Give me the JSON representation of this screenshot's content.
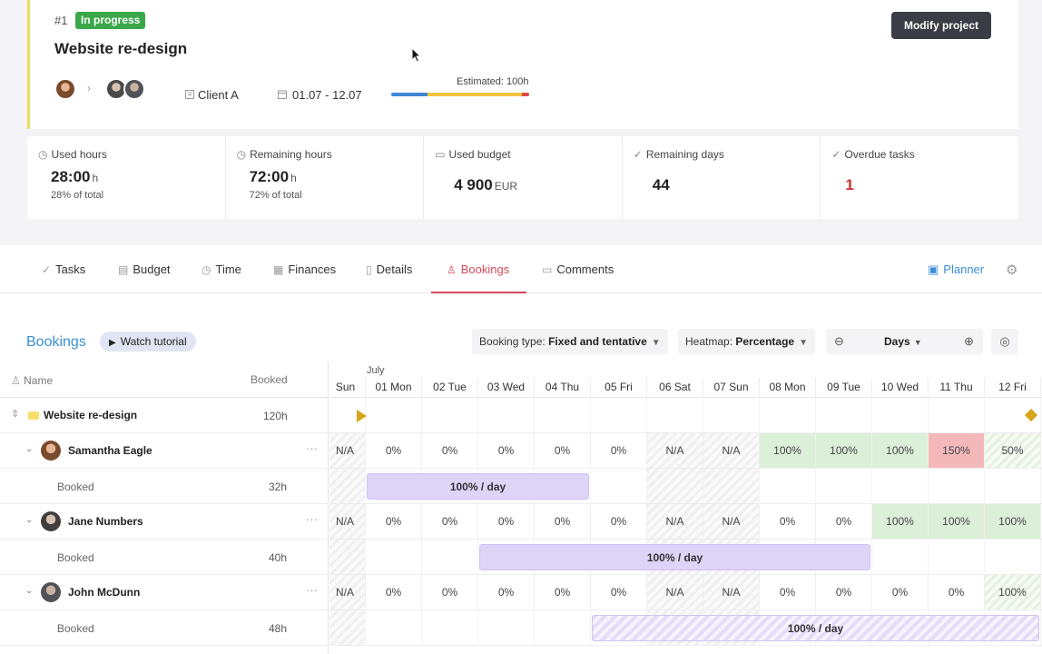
{
  "project": {
    "number": "#1",
    "status": "In progress",
    "title": "Website re-design",
    "modify_label": "Modify project",
    "client": "Client A",
    "dates": "01.07 - 12.07",
    "estimate_label": "Estimated: 100h"
  },
  "stats": [
    {
      "label": "Used hours",
      "value": "28:00",
      "unit": "h",
      "sub": "28% of total",
      "icon": "clock-icon"
    },
    {
      "label": "Remaining hours",
      "value": "72:00",
      "unit": "h",
      "sub": "72% of total",
      "icon": "timer-icon"
    },
    {
      "label": "Used budget",
      "value": "4 900",
      "unit": "EUR",
      "sub": "",
      "icon": "wallet-icon"
    },
    {
      "label": "Remaining days",
      "value": "44",
      "unit": "",
      "sub": "",
      "icon": "check-icon"
    },
    {
      "label": "Overdue tasks",
      "value": "1",
      "unit": "",
      "sub": "",
      "icon": "check-icon"
    }
  ],
  "tabs": [
    {
      "label": "Tasks",
      "icon": "check-icon"
    },
    {
      "label": "Budget",
      "icon": "budget-icon"
    },
    {
      "label": "Time",
      "icon": "clock-icon"
    },
    {
      "label": "Finances",
      "icon": "finances-icon"
    },
    {
      "label": "Details",
      "icon": "document-icon"
    },
    {
      "label": "Bookings",
      "icon": "person-icon"
    },
    {
      "label": "Comments",
      "icon": "comment-icon"
    }
  ],
  "active_tab": "Bookings",
  "planner_label": "Planner",
  "bookings": {
    "title": "Bookings",
    "tutorial_label": "Watch tutorial",
    "booking_type_label": "Booking type:",
    "booking_type_value": "Fixed and tentative",
    "heatmap_label": "Heatmap:",
    "heatmap_value": "Percentage",
    "zoom_unit": "Days"
  },
  "list_header": {
    "name": "Name",
    "booked": "Booked"
  },
  "project_row": {
    "name": "Website re-design",
    "hours": "120h"
  },
  "people": [
    {
      "name": "Samantha Eagle",
      "booked_label": "Booked",
      "booked_hours": "32h"
    },
    {
      "name": "Jane Numbers",
      "booked_label": "Booked",
      "booked_hours": "40h"
    },
    {
      "name": "John McDunn",
      "booked_label": "Booked",
      "booked_hours": "48h"
    }
  ],
  "timeline": {
    "month": "July",
    "days": [
      "Sun",
      "01 Mon",
      "02 Tue",
      "03 Wed",
      "04 Thu",
      "05 Fri",
      "06 Sat",
      "07 Sun",
      "08 Mon",
      "09 Tue",
      "10 Wed",
      "11 Thu",
      "12 Fri"
    ],
    "weekend_flags": [
      true,
      false,
      false,
      false,
      false,
      false,
      true,
      true,
      false,
      false,
      false,
      false,
      false
    ],
    "heatmap": [
      [
        "N/A",
        "0%",
        "0%",
        "0%",
        "0%",
        "0%",
        "N/A",
        "N/A",
        "100%",
        "100%",
        "100%",
        "150%",
        "50%"
      ],
      [
        "N/A",
        "0%",
        "0%",
        "0%",
        "0%",
        "0%",
        "N/A",
        "N/A",
        "0%",
        "0%",
        "100%",
        "100%",
        "100%"
      ],
      [
        "N/A",
        "0%",
        "0%",
        "0%",
        "0%",
        "0%",
        "N/A",
        "N/A",
        "0%",
        "0%",
        "0%",
        "0%",
        "100%"
      ]
    ],
    "heat_styles": [
      [
        "wk",
        "",
        "",
        "",
        "",
        "",
        "wk",
        "wk",
        "green",
        "green",
        "green",
        "red",
        "greenhatch"
      ],
      [
        "wk",
        "",
        "",
        "",
        "",
        "",
        "wk",
        "wk",
        "",
        "",
        "green",
        "green",
        "green"
      ],
      [
        "wk",
        "",
        "",
        "",
        "",
        "",
        "wk",
        "wk",
        "",
        "",
        "",
        "",
        "greenhatch"
      ]
    ],
    "bookings": [
      {
        "label": "100% / day",
        "start": 1,
        "end": 4,
        "tentative": false
      },
      {
        "label": "100% / day",
        "start": 3,
        "end": 9,
        "tentative": false
      },
      {
        "label": "100% / day",
        "start": 5,
        "end": 12,
        "tentative": true
      }
    ]
  }
}
